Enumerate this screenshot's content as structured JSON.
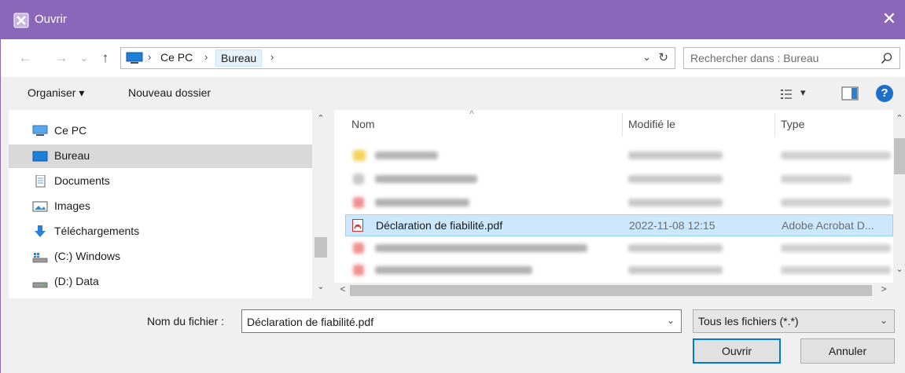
{
  "titlebar": {
    "title": "Ouvrir",
    "close_glyph": "✕",
    "app_icon": "app-icon"
  },
  "nav": {
    "back_glyph": "←",
    "forward_glyph": "→",
    "recent_glyph": "⌄",
    "up_glyph": "↑",
    "address": {
      "segments": [
        "Ce PC",
        "Bureau"
      ],
      "sep_glyph": "›",
      "dropdown_glyph": "⌄",
      "refresh_glyph": "↻"
    },
    "search": {
      "placeholder": "Rechercher dans : Bureau"
    }
  },
  "toolbar": {
    "organize_label": "Organiser ▾",
    "new_folder_label": "Nouveau dossier",
    "view_dd_glyph": "▾",
    "help_glyph": "?"
  },
  "sidebar": {
    "items": [
      {
        "label": "Ce PC",
        "icon": "computer-icon"
      },
      {
        "label": "Bureau",
        "icon": "desktop-icon",
        "selected": true
      },
      {
        "label": "Documents",
        "icon": "documents-icon"
      },
      {
        "label": "Images",
        "icon": "images-icon"
      },
      {
        "label": "Téléchargements",
        "icon": "download-icon"
      },
      {
        "label": "(C:) Windows",
        "icon": "drive-windows-icon"
      },
      {
        "label": "(D:) Data",
        "icon": "drive-icon"
      }
    ],
    "scroll_up_glyph": "⌃",
    "scroll_down_glyph": "⌄"
  },
  "files": {
    "columns": {
      "name": "Nom",
      "modified": "Modifié le",
      "type": "Type"
    },
    "sort_glyph": "^",
    "selected": {
      "name": "Déclaration de fiabilité.pdf",
      "modified": "2022-11-08 12:15",
      "type": "Adobe Acrobat D..."
    },
    "scroll_up_glyph": "⌃",
    "scroll_down_glyph": "⌄",
    "scroll_left_glyph": "<",
    "scroll_right_glyph": ">"
  },
  "bottom": {
    "filename_label": "Nom du fichier :",
    "filename_value": "Déclaration de fiabilité.pdf",
    "filename_dd_glyph": "⌄",
    "filetype_value": "Tous les fichiers (*.*)",
    "filetype_dd_glyph": "⌄",
    "open_label": "Ouvrir",
    "cancel_label": "Annuler"
  },
  "colors": {
    "titlebar": "#8b67b9",
    "selection": "#cce8ff",
    "help": "#1e6fc8"
  }
}
